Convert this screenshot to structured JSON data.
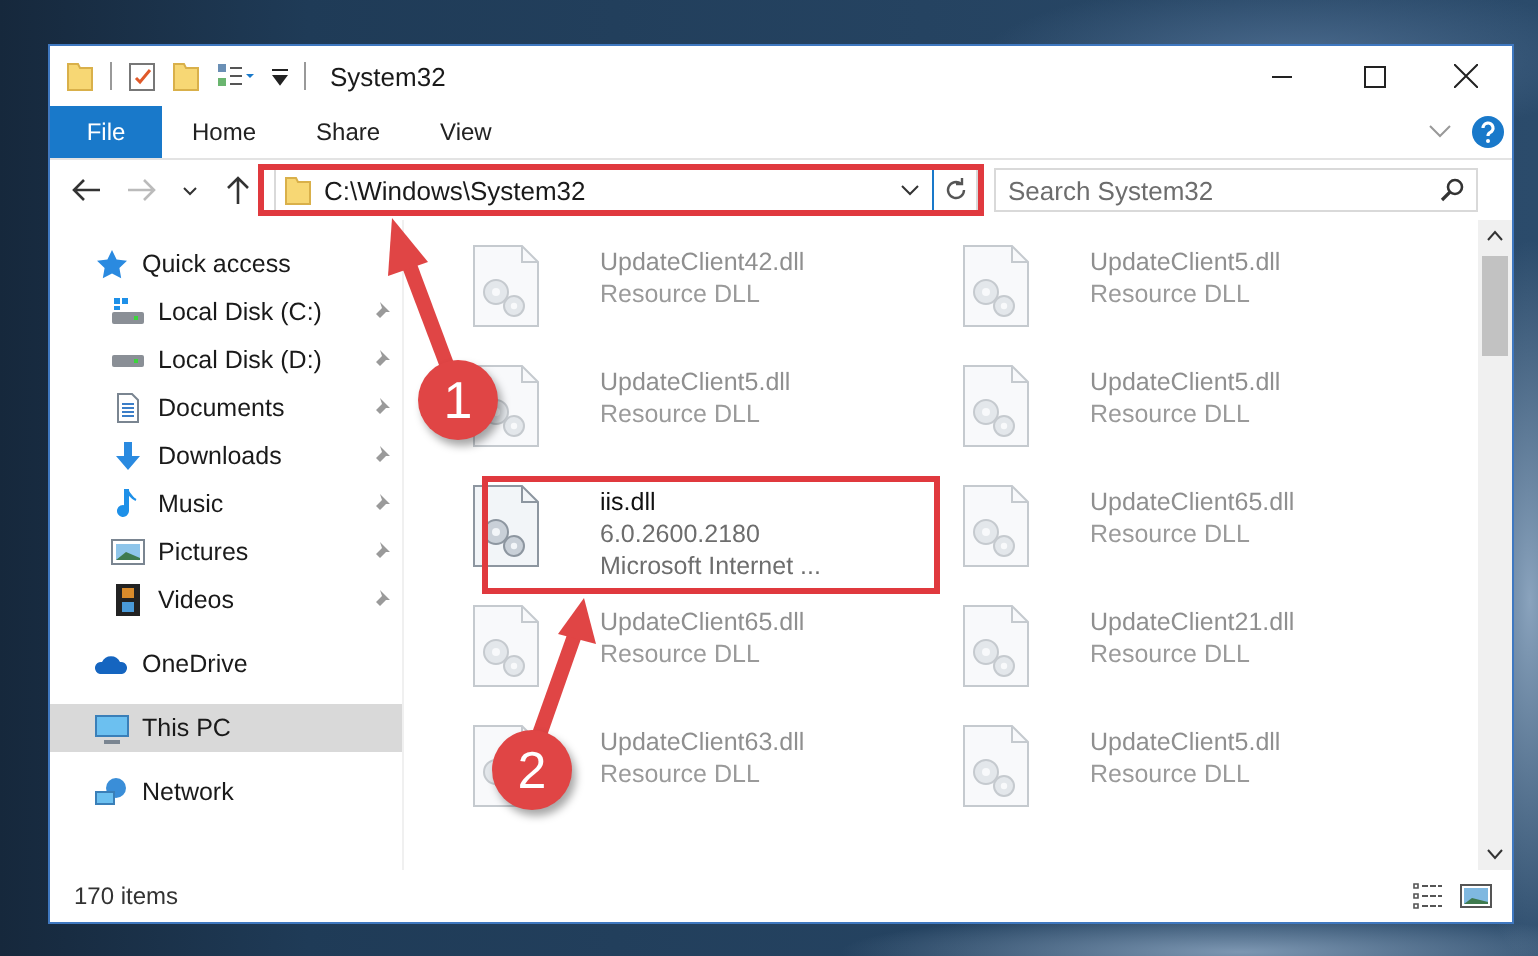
{
  "window": {
    "title": "System32"
  },
  "ribbon": {
    "tabs": [
      {
        "label": "File",
        "kind": "menu"
      },
      {
        "label": "Home",
        "kind": "tab"
      },
      {
        "label": "Share",
        "kind": "tab"
      },
      {
        "label": "View",
        "kind": "tab"
      }
    ]
  },
  "address_bar": {
    "path": "C:\\Windows\\System32"
  },
  "search": {
    "placeholder": "Search System32"
  },
  "sidebar": {
    "items": [
      {
        "label": "Quick access",
        "kind": "star",
        "selected": false,
        "children": [
          {
            "label": "Local Disk (C:)",
            "kind": "system-drive",
            "selected": false,
            "pinned": true
          },
          {
            "label": "Local Disk (D:)",
            "kind": "drive",
            "selected": false,
            "pinned": true
          },
          {
            "label": "Documents",
            "kind": "documents",
            "selected": false,
            "pinned": true
          },
          {
            "label": "Downloads",
            "kind": "downloads",
            "selected": false,
            "pinned": true
          },
          {
            "label": "Music",
            "kind": "music",
            "selected": false,
            "pinned": true
          },
          {
            "label": "Pictures",
            "kind": "pictures",
            "selected": false,
            "pinned": true
          },
          {
            "label": "Videos",
            "kind": "videos",
            "selected": false,
            "pinned": true
          }
        ]
      },
      {
        "label": "OneDrive",
        "kind": "cloud",
        "selected": false
      },
      {
        "label": "This PC",
        "kind": "pc",
        "selected": true
      },
      {
        "label": "Network",
        "kind": "network",
        "selected": false
      }
    ]
  },
  "files": [
    {
      "name": "UpdateClient42.dll",
      "details": [
        "Resource DLL"
      ],
      "faded": true
    },
    {
      "name": "UpdateClient5.dll",
      "details": [
        "Resource DLL"
      ],
      "faded": true
    },
    {
      "name": "UpdateClient5.dll",
      "details": [
        "Resource DLL"
      ],
      "faded": true
    },
    {
      "name": "UpdateClient5.dll",
      "details": [
        "Resource DLL"
      ],
      "faded": true
    },
    {
      "name": "iis.dll",
      "details": [
        "6.0.2600.2180",
        "Microsoft Internet ..."
      ],
      "faded": false
    },
    {
      "name": "UpdateClient65.dll",
      "details": [
        "Resource DLL"
      ],
      "faded": true
    },
    {
      "name": "UpdateClient65.dll",
      "details": [
        "Resource DLL"
      ],
      "faded": true
    },
    {
      "name": "UpdateClient21.dll",
      "details": [
        "Resource DLL"
      ],
      "faded": true
    },
    {
      "name": "UpdateClient63.dll",
      "details": [
        "Resource DLL"
      ],
      "faded": true
    },
    {
      "name": "UpdateClient5.dll",
      "details": [
        "Resource DLL"
      ],
      "faded": true
    }
  ],
  "status_bar": {
    "item_count": "170 items"
  },
  "annotations": [
    {
      "number": "1"
    },
    {
      "number": "2"
    }
  ]
}
